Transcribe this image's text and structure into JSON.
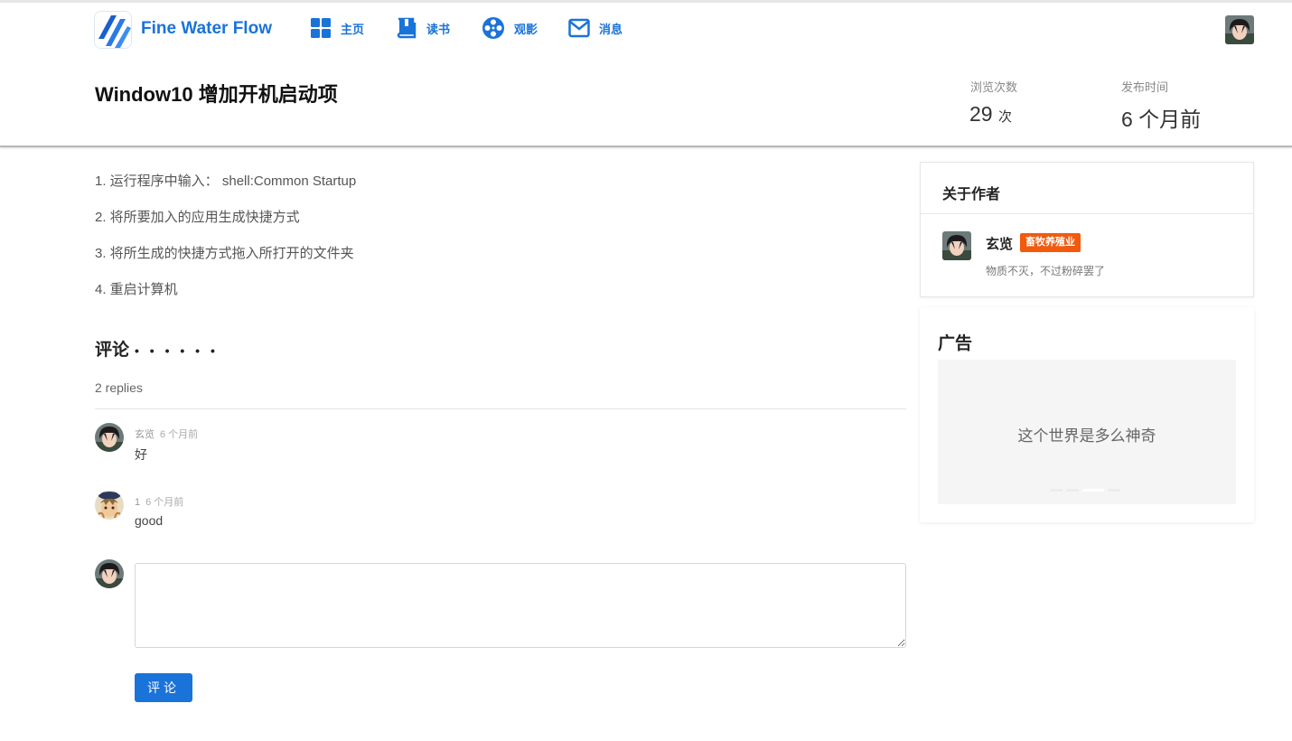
{
  "brand": {
    "name": "Fine Water Flow",
    "logo_icon": "waves-logo-icon",
    "color": "#1a73d9"
  },
  "nav": {
    "items": [
      {
        "label": "主页",
        "icon": "grid-icon"
      },
      {
        "label": "读书",
        "icon": "book-icon"
      },
      {
        "label": "观影",
        "icon": "film-reel-icon"
      },
      {
        "label": "消息",
        "icon": "mail-icon"
      }
    ]
  },
  "post": {
    "title": "Window10 增加开机启动项",
    "views_label": "浏览次数",
    "views_value": "29",
    "views_unit": "次",
    "published_label": "发布时间",
    "published_value": "6 个月前"
  },
  "steps": [
    "1. 运行程序中输入： shell:Common Startup",
    "2. 将所要加入的应用生成快捷方式",
    "3. 将所生成的快捷方式拖入所打开的文件夹",
    "4. 重启计算机"
  ],
  "comments_section": {
    "title": "评论",
    "dots": "• • • • • •",
    "replies": "2 replies",
    "items": [
      {
        "author": "玄览",
        "time": "6 个月前",
        "text": "好"
      },
      {
        "author": "1",
        "time": "6 个月前",
        "text": "good"
      }
    ],
    "submit_label": "评论"
  },
  "author_card": {
    "title": "关于作者",
    "name": "玄览",
    "tag": "畜牧养殖业",
    "bio": "物质不灭，不过粉碎罢了",
    "tag_color": "#f25a0e"
  },
  "ad_card": {
    "title": "广告",
    "banner_text": "这个世界是多么神奇"
  }
}
